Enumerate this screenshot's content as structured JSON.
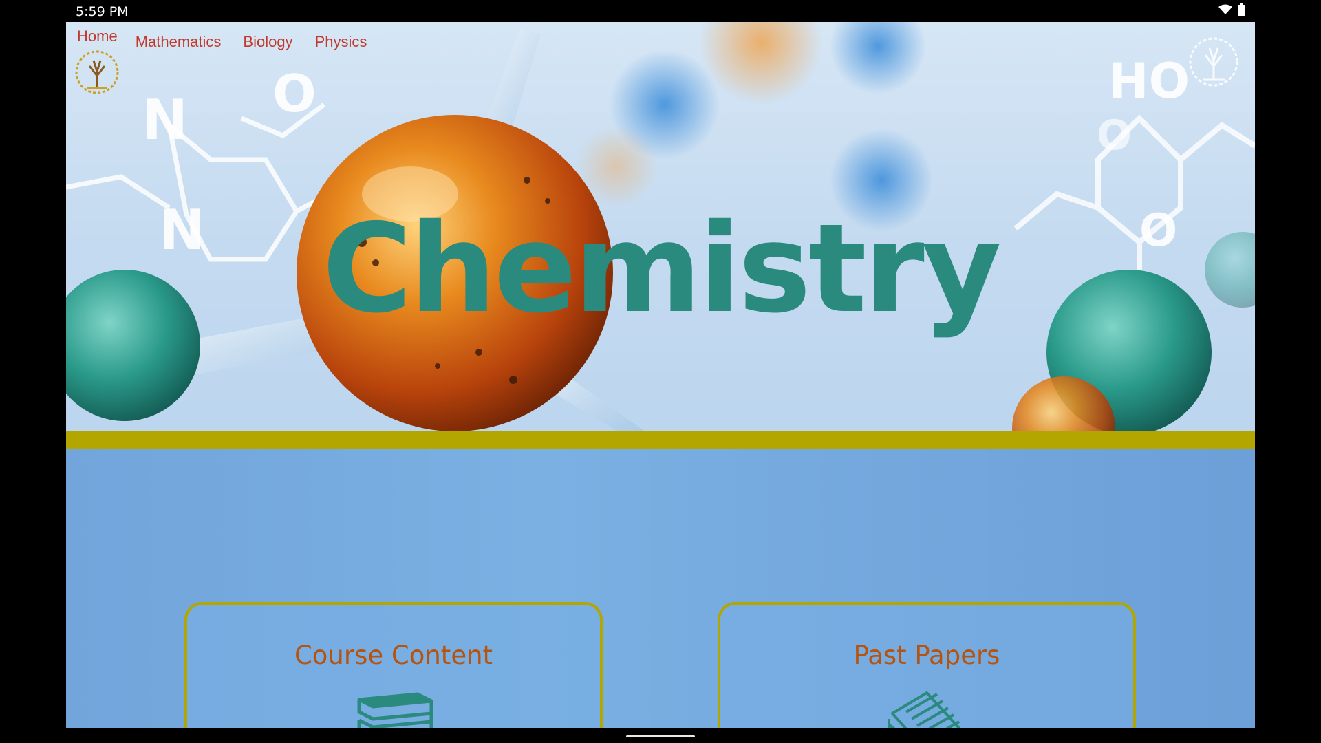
{
  "status_bar": {
    "time": "5:59 PM",
    "icons": [
      "wifi-icon",
      "battery-icon"
    ]
  },
  "nav": {
    "items": [
      {
        "label": "Home",
        "active": true
      },
      {
        "label": "Mathematics"
      },
      {
        "label": "Biology"
      },
      {
        "label": "Physics"
      }
    ]
  },
  "hero": {
    "title": "Chemistry",
    "background_molecule_labels": [
      "N",
      "N",
      "O",
      "HO",
      "O",
      "O"
    ],
    "title_color": "#2b8a7e"
  },
  "cards": [
    {
      "label": "Course Content",
      "icon": "books-icon"
    },
    {
      "label": "Past Papers",
      "icon": "papers-icon"
    }
  ],
  "colors": {
    "accent_bar": "#b3a600",
    "nav_text": "#c0392b",
    "card_text": "#b5530f",
    "icon": "#2b8a7e"
  }
}
